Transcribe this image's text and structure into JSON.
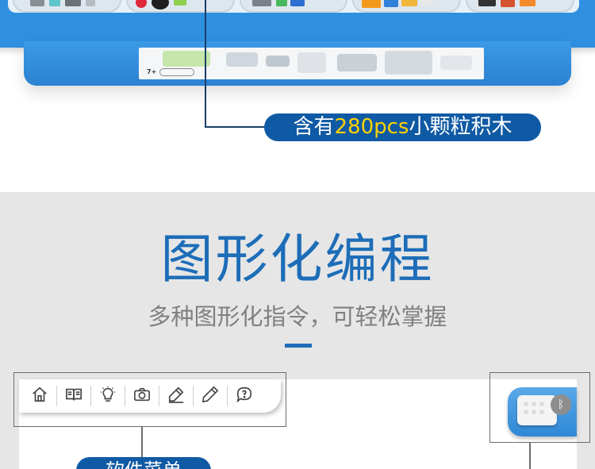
{
  "product": {
    "callout_prefix": "含有",
    "callout_highlight": "280pcs",
    "callout_suffix": "小颗粒积木",
    "age_label": "7+"
  },
  "section": {
    "title": "图形化编程",
    "subtitle": "多种图形化指令，可轻松掌握"
  },
  "toolbar": {
    "buttons": [
      {
        "icon": "home-icon"
      },
      {
        "icon": "book-icon"
      },
      {
        "icon": "lightbulb-icon"
      },
      {
        "icon": "camera-icon"
      },
      {
        "icon": "pen-icon"
      },
      {
        "icon": "pencil-icon"
      },
      {
        "icon": "help-chat-icon"
      }
    ]
  },
  "hub": {
    "bluetooth_symbol": "ᛒ"
  },
  "bottom_callout": {
    "label": "软件菜单"
  },
  "colors": {
    "brand_blue": "#1d6db8",
    "pill_blue": "#0f5aa4",
    "highlight": "#ffd200",
    "tray_blue": "#2f8fe0"
  }
}
